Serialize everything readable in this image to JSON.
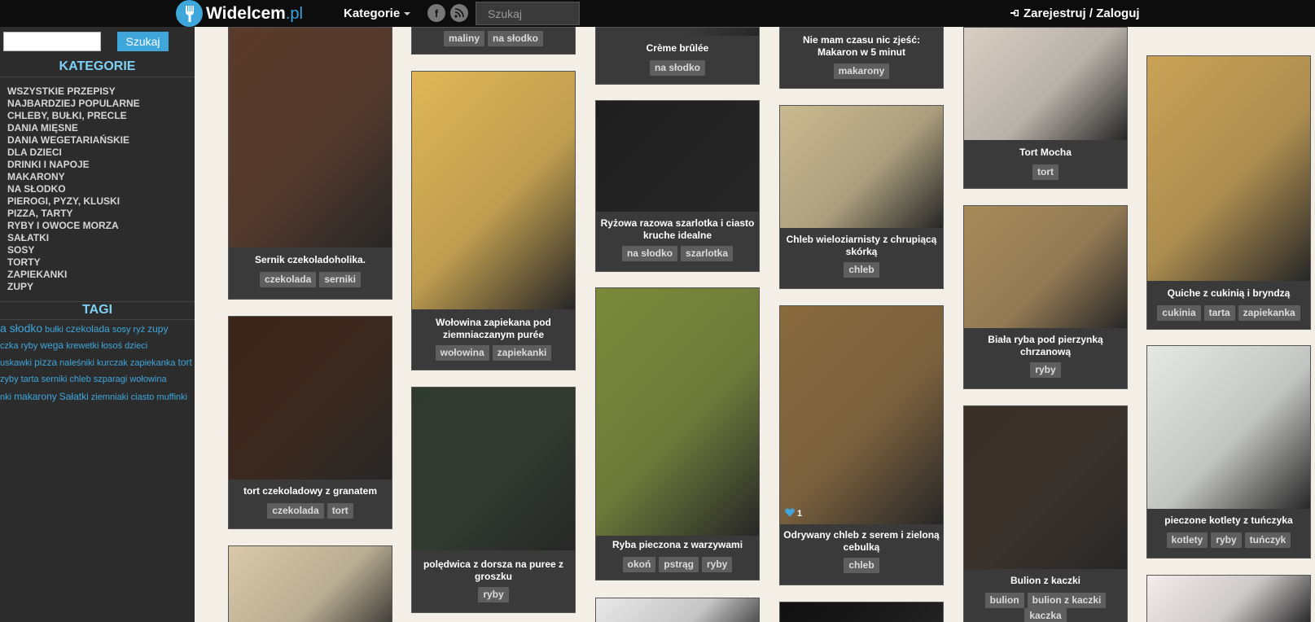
{
  "header": {
    "logo_name": "Widelcem",
    "logo_tld": ".pl",
    "kategorie": "Kategorie",
    "search_placeholder": "Szukaj",
    "login": "Zarejestruj / Zaloguj",
    "facebook_glyph": "f",
    "rss_glyph": "◤"
  },
  "sidebar": {
    "search_button": "Szukaj",
    "categories_heading": "KATEGORIE",
    "categories": [
      "WSZYSTKIE PRZEPISY",
      "NAJBARDZIEJ POPULARNE",
      "CHLEBY, BUŁKI, PRECLE",
      "DANIA MIĘSNE",
      "DANIA WEGETARIAŃSKIE",
      "DLA DZIECI",
      "DRINKI I NAPOJE",
      "MAKARONY",
      "NA SŁODKO",
      "PIEROGI, PYZY, KLUSKI",
      "PIZZA, TARTY",
      "RYBY I OWOCE MORZA",
      "SAŁATKI",
      "SOSY",
      "TORTY",
      "ZAPIEKANKI",
      "ZUPY"
    ],
    "tags_heading": "TAGI",
    "tag_rows": [
      [
        [
          "a słodko",
          "lg"
        ],
        [
          "bułki",
          "sm"
        ],
        [
          "czekolada",
          "md"
        ],
        [
          "sosy",
          "sm"
        ],
        [
          "ryż",
          "sm"
        ],
        [
          "zupy",
          "md"
        ]
      ],
      [
        [
          "czka",
          "sm"
        ],
        [
          "ryby",
          "sm"
        ],
        [
          "wega",
          "md"
        ],
        [
          "krewetki",
          "sm"
        ],
        [
          "łosoś",
          "sm"
        ],
        [
          "dzieci",
          "sm"
        ]
      ],
      [
        [
          "uskawki",
          "sm"
        ],
        [
          "pizza",
          "md"
        ],
        [
          "naleśniki",
          "sm"
        ],
        [
          "kurczak",
          "sm"
        ],
        [
          "zapiekanka",
          "sm"
        ],
        [
          "tort",
          "md"
        ]
      ],
      [
        [
          "zyby",
          "sm"
        ],
        [
          "tarta",
          "sm"
        ],
        [
          "serniki",
          "sm"
        ],
        [
          "chleb",
          "sm"
        ],
        [
          "szparagi",
          "sm"
        ],
        [
          "wołowina",
          "sm"
        ]
      ],
      [
        [
          "nki",
          "sm"
        ],
        [
          "makarony",
          "md"
        ],
        [
          "Sałatki",
          "md"
        ],
        [
          "ziemniaki",
          "sm"
        ],
        [
          "ciasto",
          "sm"
        ],
        [
          "muffinki",
          "sm"
        ]
      ]
    ]
  },
  "pins": [
    {
      "title": "Sernik czekoladoholika.",
      "tags": [
        "czekolada",
        "serniki"
      ],
      "color": "#5a3a2a"
    },
    {
      "title": "tort czekoladowy z granatem",
      "tags": [
        "czekolada",
        "tort"
      ],
      "color": "#3b2418"
    },
    {
      "title": "",
      "tags": [],
      "color": "#d8c9a8"
    },
    {
      "title": "",
      "tags": [
        "maliny",
        "na słodko"
      ],
      "color": "#3a3a3a"
    },
    {
      "title": "Wołowina zapiekana pod ziemniaczanym purée",
      "tags": [
        "wołowina",
        "zapiekanki"
      ],
      "color": "#e0b656"
    },
    {
      "title": "polędwica z dorsza na puree z groszku",
      "tags": [
        "ryby"
      ],
      "color": "#2f3a2e"
    },
    {
      "title": "Crème brûlée",
      "tags": [
        "na słodko"
      ],
      "color": "#3a3a3a"
    },
    {
      "title": "Ryżowa razowa szarlotka i ciasto kruche idealne",
      "tags": [
        "na słodko",
        "szarlotka"
      ],
      "color": "#1e1e1e"
    },
    {
      "title": "Ryba pieczona z warzywami",
      "tags": [
        "okoń",
        "pstrąg",
        "ryby"
      ],
      "color": "#7a8a3a"
    },
    {
      "title": "",
      "tags": [],
      "color": "#e8e8e8"
    },
    {
      "title": "Nie mam czasu nic zjeść: Makaron w 5 minut",
      "tags": [
        "makarony"
      ],
      "color": "#3a3a3a"
    },
    {
      "title": "Chleb wieloziarnisty z chrupiącą skórką",
      "tags": [
        "chleb"
      ],
      "color": "#c9b98f"
    },
    {
      "title": "Odrywany chleb z serem i zieloną cebulką",
      "tags": [
        "chleb"
      ],
      "color": "#8a6a3e",
      "likes": "1"
    },
    {
      "title": "",
      "tags": [],
      "color": "#111111"
    },
    {
      "title": "Tort Mocha",
      "tags": [
        "tort"
      ],
      "color": "#d8cfc4"
    },
    {
      "title": "Biała ryba pod pierzynką chrzanową",
      "tags": [
        "ryby"
      ],
      "color": "#a88a5a"
    },
    {
      "title": "Bulion z kaczki",
      "tags": [
        "bulion",
        "bulion z kaczki",
        "kaczka"
      ],
      "color": "#3a3028"
    },
    {
      "title": "Quiche z cukinią i bryndzą",
      "tags": [
        "cukinia",
        "tarta",
        "zapiekanka"
      ],
      "color": "#c9a255"
    },
    {
      "title": "pieczone kotlety z tuńczyka",
      "tags": [
        "kotlety",
        "ryby",
        "tuńczyk"
      ],
      "color": "#e6e8e4"
    },
    {
      "title": "",
      "tags": [],
      "color": "#f2ecec"
    }
  ]
}
